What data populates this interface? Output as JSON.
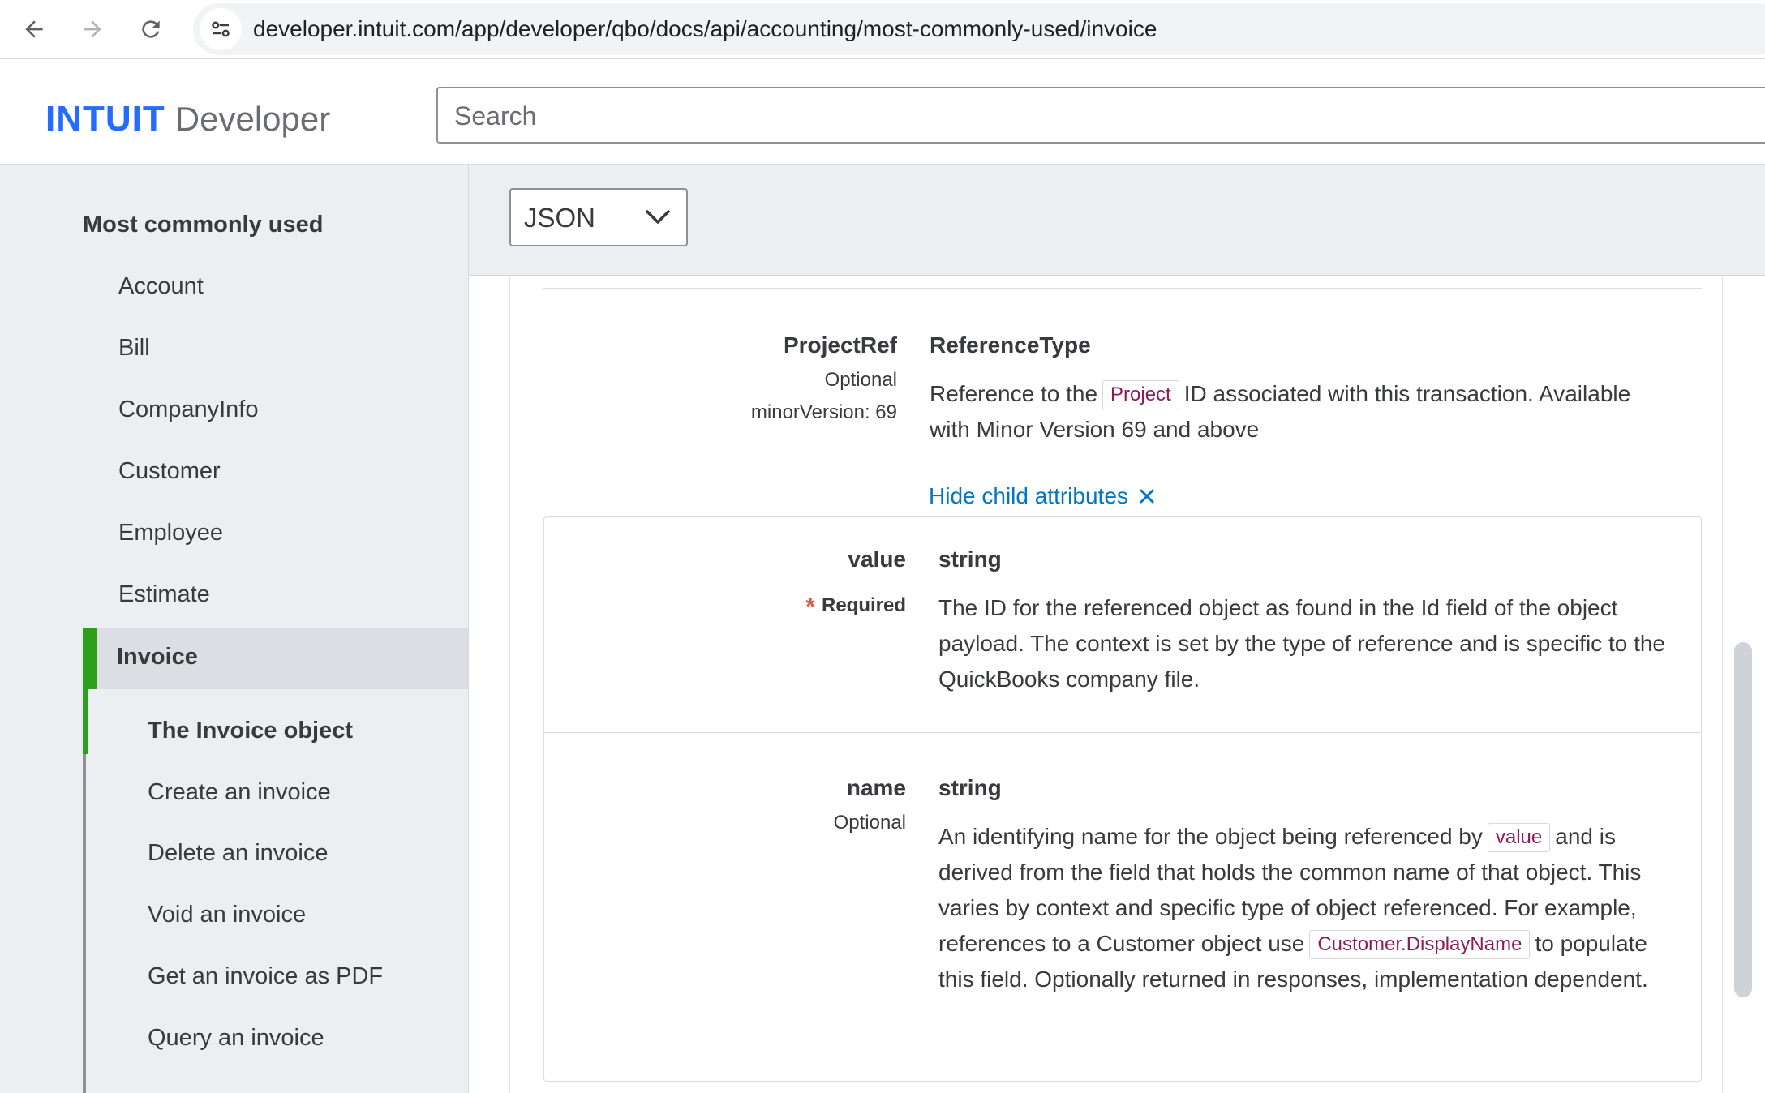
{
  "browser": {
    "url": "developer.intuit.com/app/developer/qbo/docs/api/accounting/most-commonly-used/invoice"
  },
  "header": {
    "logo_brand": "INTUIT",
    "logo_product": "Developer",
    "search_placeholder": "Search"
  },
  "sidebar": {
    "heading": "Most commonly used",
    "items": [
      {
        "label": "Account"
      },
      {
        "label": "Bill"
      },
      {
        "label": "CompanyInfo"
      },
      {
        "label": "Customer"
      },
      {
        "label": "Employee"
      },
      {
        "label": "Estimate"
      },
      {
        "label": "Invoice",
        "active": true
      }
    ],
    "sub_items": [
      {
        "label": "The Invoice object",
        "active": true
      },
      {
        "label": "Create an invoice"
      },
      {
        "label": "Delete an invoice"
      },
      {
        "label": "Void an invoice"
      },
      {
        "label": "Get an invoice as PDF"
      },
      {
        "label": "Query an invoice"
      }
    ]
  },
  "language_select": {
    "value": "JSON"
  },
  "attributes": {
    "project_ref": {
      "name": "ProjectRef",
      "optional": "Optional",
      "minor_version": "minorVersion: 69",
      "type": "ReferenceType",
      "desc_before": "Reference to the",
      "desc_tag": "Project",
      "desc_after": "ID associated with this transaction. Available with Minor Version 69 and above",
      "hide_child_label": "Hide child attributes"
    },
    "value": {
      "name": "value",
      "required": "Required",
      "type": "string",
      "description": "The ID for the referenced object as found in the Id field of the object payload. The context is set by the type of reference and is specific to the QuickBooks company file."
    },
    "name": {
      "name": "name",
      "optional": "Optional",
      "type": "string",
      "desc_part1": "An identifying name for the object being referenced by",
      "desc_tag1": "value",
      "desc_part2": "and is derived from the field that holds the common name of that object. This varies by context and specific type of object referenced. For example, references to a Customer object use",
      "desc_tag2": "Customer.DisplayName",
      "desc_part3": "to populate this field. Optionally returned in responses, implementation dependent."
    }
  },
  "colors": {
    "accent_green": "#2ca01c",
    "link_blue": "#0077c5",
    "brand_blue": "#236cff",
    "code_text": "#8d1b5a",
    "required_star": "#e0533d"
  }
}
